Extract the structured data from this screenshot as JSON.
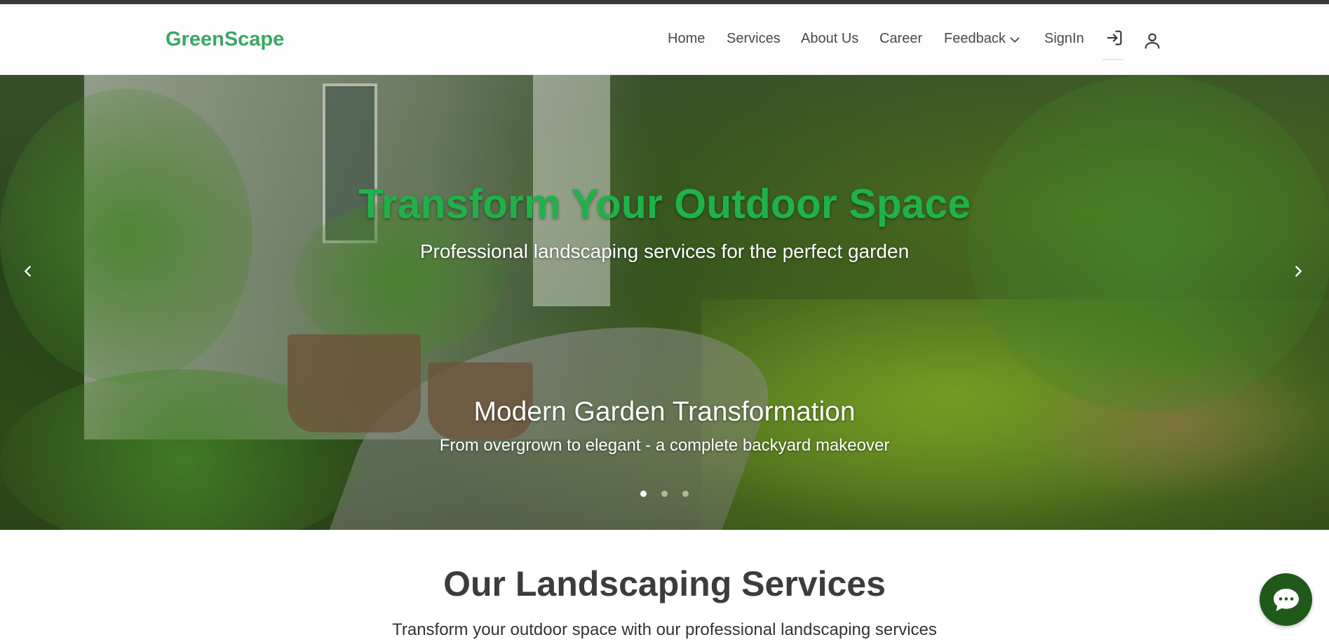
{
  "brand": {
    "name": "GreenScape",
    "color": "#3aa764"
  },
  "nav": {
    "items": [
      {
        "label": "Home"
      },
      {
        "label": "Services"
      },
      {
        "label": "About Us"
      },
      {
        "label": "Career"
      },
      {
        "label": "Feedback"
      },
      {
        "label": "SignIn"
      }
    ],
    "icons": [
      "chevron-down-icon",
      "login-icon",
      "user-icon"
    ]
  },
  "hero": {
    "title": "Transform Your Outdoor Space",
    "subtitle": "Professional landscaping services for the perfect garden",
    "title_color": "#1fb24a",
    "slide": {
      "caption_title": "Modern Garden Transformation",
      "caption_text": "From overgrown to elegant - a complete backyard makeover"
    },
    "carousel": {
      "slide_count": 3,
      "active_index": 0,
      "prev_icon": "chevron-left-icon",
      "next_icon": "chevron-right-icon"
    }
  },
  "services": {
    "title": "Our Landscaping Services",
    "subtitle": "Transform your outdoor space with our professional landscaping services"
  },
  "chat": {
    "icon": "chat-bubble-icon",
    "color": "#1f5a1a"
  }
}
